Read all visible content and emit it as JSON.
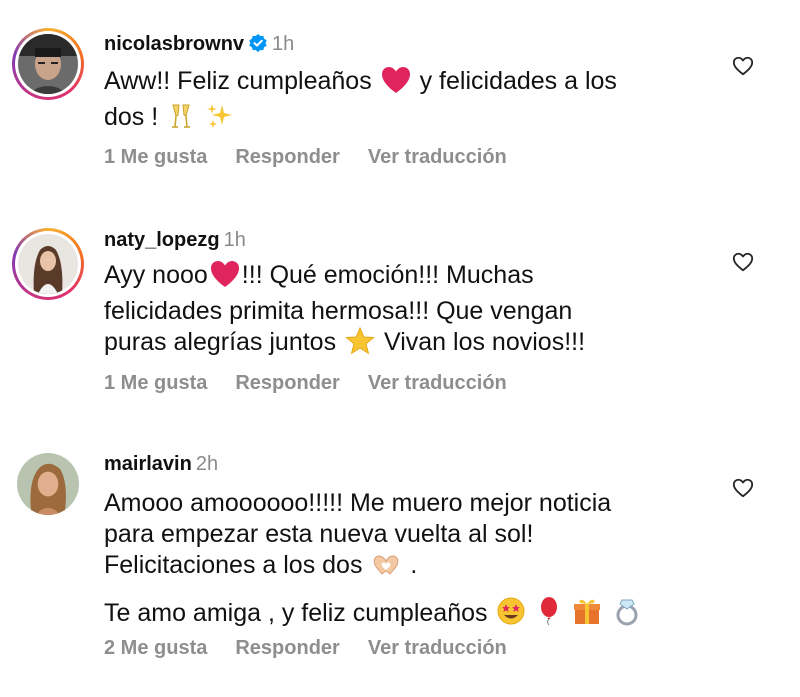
{
  "comments": [
    {
      "username": "nicolasbrownv",
      "time": "1h",
      "verified": true,
      "text_lines": [
        "Aww!! Feliz cumpleaños",
        "y felicidades a los",
        "dos !"
      ],
      "likes": "1 Me gusta",
      "reply": "Responder",
      "translate": "Ver traducción"
    },
    {
      "username": "naty_lopezg",
      "time": "1h",
      "verified": false,
      "text_lines": [
        "Ayy nooo",
        "!!! Qué emoción!!! Muchas",
        "felicidades primita hermosa!!! Que vengan",
        "puras alegrías juntos",
        "Vivan los novios!!!"
      ],
      "likes": "1 Me gusta",
      "reply": "Responder",
      "translate": "Ver traducción"
    },
    {
      "username": "mairlavin",
      "time": "2h",
      "verified": false,
      "text_lines": [
        "Amooo  amoooooo!!!!! Me muero mejor noticia",
        "para empezar esta nueva vuelta al sol!",
        "Felicitaciones a los dos",
        ".",
        "Te amo amiga , y feliz cumpleaños"
      ],
      "likes": "2 Me gusta",
      "reply": "Responder",
      "translate": "Ver traducción"
    }
  ],
  "icons": {
    "like": "heart-outline-icon",
    "verified": "verified-badge-icon"
  },
  "colors": {
    "secondary_text": "#8e8e8e",
    "verified_blue": "#0095f6",
    "emoji_heart": "#e0245e"
  }
}
